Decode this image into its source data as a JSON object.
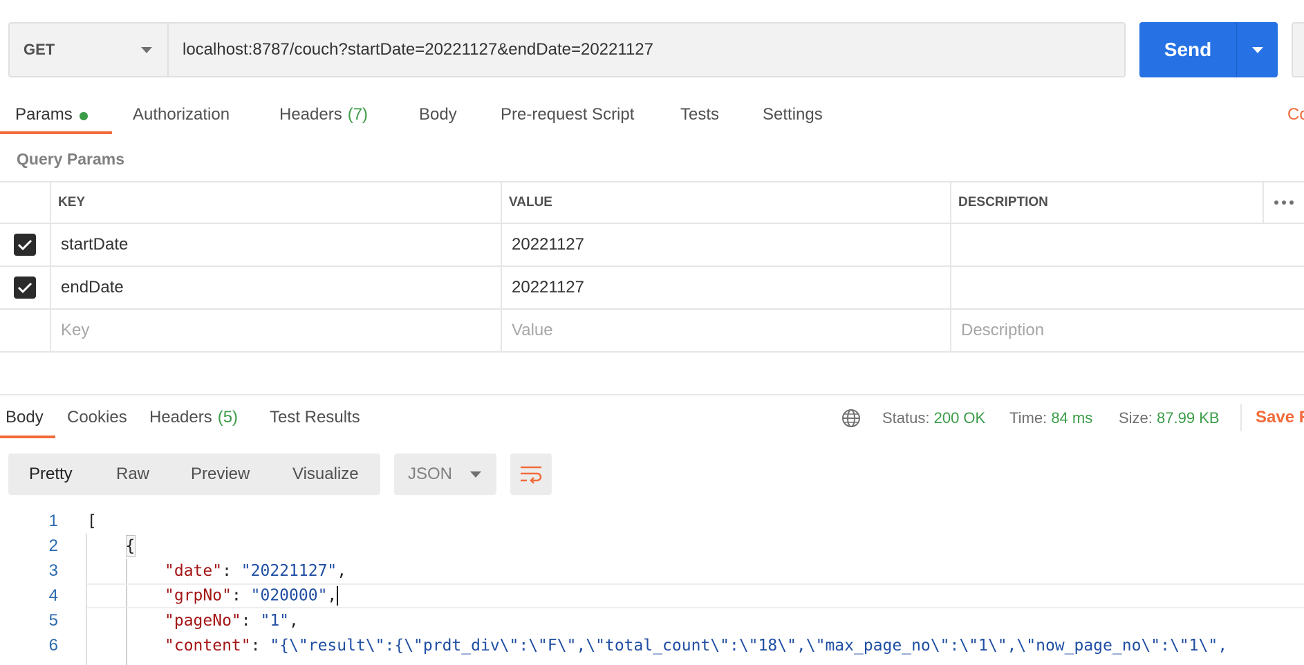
{
  "request": {
    "method": "GET",
    "url": "localhost:8787/couch?startDate=20221127&endDate=20221127",
    "send_label": "Send"
  },
  "request_tabs": [
    {
      "label": "Params",
      "active": true,
      "indicator": "green-dot"
    },
    {
      "label": "Authorization"
    },
    {
      "label": "Headers",
      "count": "(7)"
    },
    {
      "label": "Body"
    },
    {
      "label": "Pre-request Script"
    },
    {
      "label": "Tests"
    },
    {
      "label": "Settings"
    }
  ],
  "cookies_link_partial": "Co",
  "query_params": {
    "title": "Query Params",
    "columns": {
      "key": "KEY",
      "value": "VALUE",
      "description": "DESCRIPTION"
    },
    "rows": [
      {
        "checked": true,
        "key": "startDate",
        "value": "20221127",
        "description": ""
      },
      {
        "checked": true,
        "key": "endDate",
        "value": "20221127",
        "description": ""
      }
    ],
    "placeholders": {
      "key": "Key",
      "value": "Value",
      "description": "Description"
    }
  },
  "response": {
    "tabs": [
      {
        "label": "Body",
        "active": true
      },
      {
        "label": "Cookies"
      },
      {
        "label": "Headers",
        "count": "(5)"
      },
      {
        "label": "Test Results"
      }
    ],
    "status_label": "Status:",
    "status_value": "200 OK",
    "time_label": "Time:",
    "time_value": "84 ms",
    "size_label": "Size:",
    "size_value": "87.99 KB",
    "save_label_partial": "Save R",
    "view_modes": [
      "Pretty",
      "Raw",
      "Preview",
      "Visualize"
    ],
    "active_view": "Pretty",
    "format": "JSON",
    "code_lines": [
      {
        "n": "1",
        "text": "["
      },
      {
        "n": "2",
        "text": "    {"
      },
      {
        "n": "3",
        "key": "\"date\"",
        "val": "\"20221127\"",
        "tail": ","
      },
      {
        "n": "4",
        "key": "\"grpNo\"",
        "val": "\"020000\"",
        "tail": ","
      },
      {
        "n": "5",
        "key": "\"pageNo\"",
        "val": "\"1\"",
        "tail": ","
      },
      {
        "n": "6",
        "key": "\"content\"",
        "val": "\"{\\\"result\\\":{\\\"prdt_div\\\":\\\"F\\\",\\\"total_count\\\":\\\"18\\\",\\\"max_page_no\\\":\\\"1\\\",\\\"now_page_no\\\":\\\"1\\\",",
        "tail": ""
      }
    ]
  },
  "colors": {
    "send": "#2672e5",
    "accent": "#f26b3a",
    "success": "#3c9c48",
    "json_key": "#a41515",
    "json_string": "#1f4ea3"
  }
}
